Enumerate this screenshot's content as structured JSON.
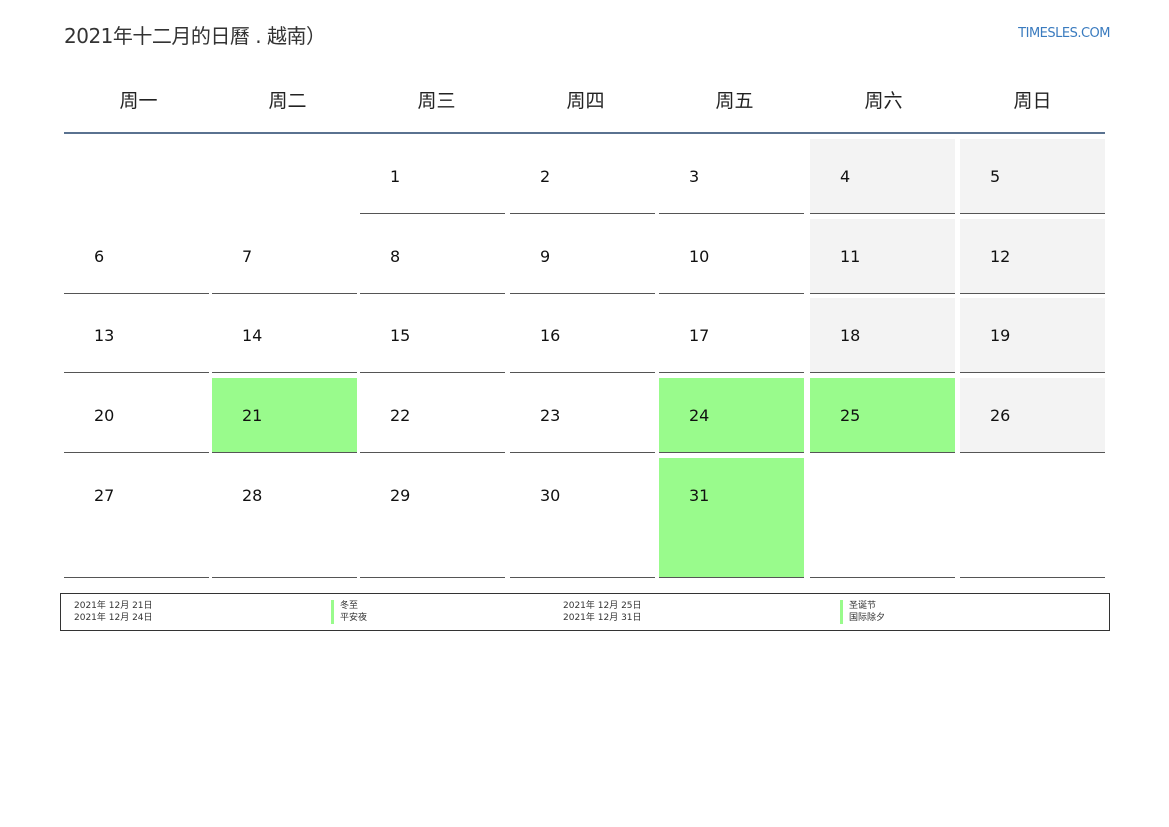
{
  "header": {
    "title": "2021年十二月的日曆 . 越南）",
    "brand": "TIMESLES.COM"
  },
  "weekdays": [
    "周一",
    "周二",
    "周三",
    "周四",
    "周五",
    "周六",
    "周日"
  ],
  "weeks": [
    [
      null,
      null,
      {
        "day": "1"
      },
      {
        "day": "2"
      },
      {
        "day": "3"
      },
      {
        "day": "4",
        "weekend": true
      },
      {
        "day": "5",
        "weekend": true
      }
    ],
    [
      {
        "day": "6"
      },
      {
        "day": "7"
      },
      {
        "day": "8"
      },
      {
        "day": "9"
      },
      {
        "day": "10"
      },
      {
        "day": "11",
        "weekend": true
      },
      {
        "day": "12",
        "weekend": true
      }
    ],
    [
      {
        "day": "13"
      },
      {
        "day": "14"
      },
      {
        "day": "15"
      },
      {
        "day": "16"
      },
      {
        "day": "17"
      },
      {
        "day": "18",
        "weekend": true
      },
      {
        "day": "19",
        "weekend": true
      }
    ],
    [
      {
        "day": "20"
      },
      {
        "day": "21",
        "holiday": true
      },
      {
        "day": "22"
      },
      {
        "day": "23"
      },
      {
        "day": "24",
        "holiday": true
      },
      {
        "day": "25",
        "holiday": true
      },
      {
        "day": "26",
        "weekend": true
      }
    ],
    [
      {
        "day": "27"
      },
      {
        "day": "28"
      },
      {
        "day": "29"
      },
      {
        "day": "30"
      },
      {
        "day": "31",
        "holiday": true
      },
      {
        "day": ""
      },
      {
        "day": ""
      }
    ]
  ],
  "legend": {
    "left": [
      {
        "date": "2021年 12月 21日",
        "name": "冬至"
      },
      {
        "date": "2021年 12月 24日",
        "name": "平安夜"
      }
    ],
    "right": [
      {
        "date": "2021年 12月 25日",
        "name": "圣诞节"
      },
      {
        "date": "2021年 12月 31日",
        "name": "国际除夕"
      }
    ]
  },
  "colors": {
    "holiday": "#99fb8c",
    "weekend": "#f3f3f3",
    "header_rule": "#5a7290",
    "brand": "#3a7bbf"
  }
}
